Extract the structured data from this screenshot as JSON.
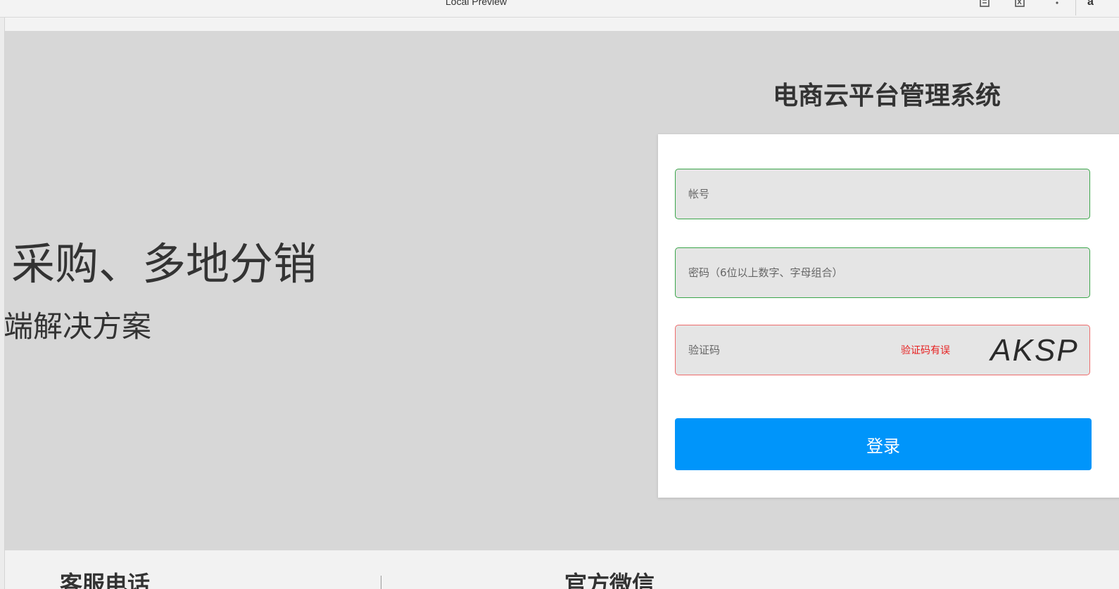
{
  "window": {
    "title": "Local Preview",
    "icons": [
      "document-icon",
      "code-icon",
      "more-vert-icon"
    ],
    "right_text": "a"
  },
  "hero": {
    "line1": "采购、多地分销",
    "line2": "端解决方案"
  },
  "login": {
    "title": "电商云平台管理系统",
    "account_placeholder": "帐号",
    "password_placeholder": "密码（6位以上数字、字母组合）",
    "captcha_placeholder": "验证码",
    "captcha_error": "验证码有误",
    "captcha_code": "AKSP",
    "submit_label": "登录"
  },
  "footer": {
    "col1_title": "客服电话",
    "col2_title": "官方微信"
  },
  "colors": {
    "primary": "#0095fa",
    "valid_border": "#3aa54a",
    "error_border": "#ee6b6b",
    "error_text": "#e62020",
    "hero_bg": "#d7d7d7"
  }
}
